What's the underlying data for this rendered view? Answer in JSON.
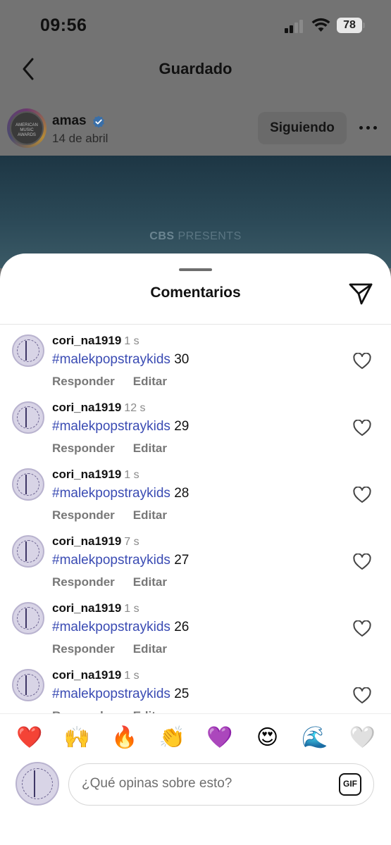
{
  "status_bar": {
    "time": "09:56",
    "battery": "78"
  },
  "nav": {
    "title": "Guardado",
    "back_icon": "chevron-left-icon"
  },
  "post": {
    "username": "amas",
    "date": "14 de abril",
    "follow_label": "Siguiendo",
    "avatar_text": "AMERICAN MUSIC AWARDS",
    "image_caption_bold": "CBS",
    "image_caption_rest": " PRESENTS"
  },
  "sheet": {
    "title": "Comentarios",
    "share_icon": "send-icon"
  },
  "comments": [
    {
      "username": "cori_na1919",
      "time": "1 s",
      "hashtag": "#malekpopstraykids",
      "number": " 30",
      "reply": "Responder",
      "edit": "Editar"
    },
    {
      "username": "cori_na1919",
      "time": "12 s",
      "hashtag": "#malekpopstraykids",
      "number": " 29",
      "reply": "Responder",
      "edit": "Editar"
    },
    {
      "username": "cori_na1919",
      "time": "1 s",
      "hashtag": "#malekpopstraykids",
      "number": " 28",
      "reply": "Responder",
      "edit": "Editar"
    },
    {
      "username": "cori_na1919",
      "time": "7 s",
      "hashtag": "#malekpopstraykids",
      "number": " 27",
      "reply": "Responder",
      "edit": "Editar"
    },
    {
      "username": "cori_na1919",
      "time": "1 s",
      "hashtag": "#malekpopstraykids",
      "number": " 26",
      "reply": "Responder",
      "edit": "Editar"
    },
    {
      "username": "cori_na1919",
      "time": "1 s",
      "hashtag": "#malekpopstraykids",
      "number": " 25",
      "reply": "Responder",
      "edit": "Editar"
    }
  ],
  "emoji_reactions": [
    "❤️",
    "🙌",
    "🔥",
    "👏",
    "💜",
    "😍",
    "🌊",
    "🤍"
  ],
  "composer": {
    "placeholder": "¿Qué opinas sobre esto?",
    "gif_label": "GIF"
  },
  "colors": {
    "hashtag": "#3a4bb3",
    "verified": "#3897f0",
    "overlay": "#737373"
  }
}
